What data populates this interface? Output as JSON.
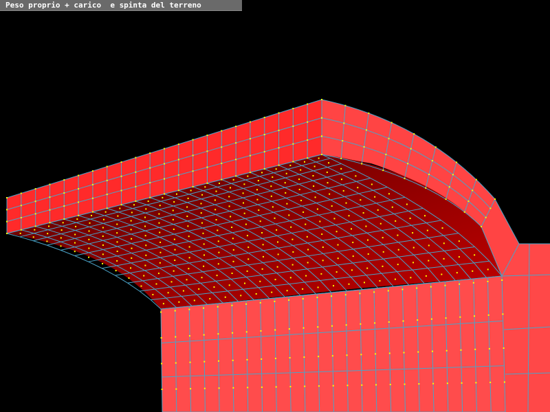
{
  "window": {
    "title": "Peso proprio + carico  e spinta del terreno"
  },
  "colors": {
    "background": "#000000",
    "face_front": "#ff4a4a",
    "face_top": "#e01818",
    "face_vault_light": "#b00000",
    "face_vault_dark": "#5a0000",
    "mesh_line": "#4aa3c8",
    "node": "#ffff00"
  }
}
